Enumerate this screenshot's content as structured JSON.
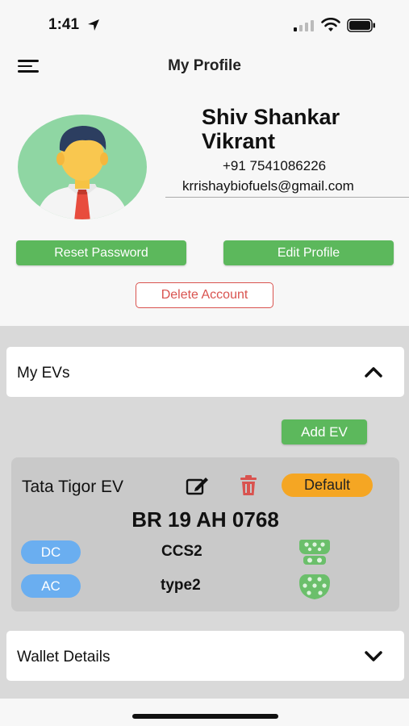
{
  "status_bar": {
    "time": "1:41"
  },
  "nav": {
    "title": "My Profile"
  },
  "profile": {
    "name": "Shiv Shankar Vikrant",
    "phone": "+91 7541086226",
    "email": "krrishaybiofuels@gmail.com",
    "reset_password_label": "Reset Password",
    "edit_profile_label": "Edit Profile",
    "delete_account_label": "Delete Account"
  },
  "sections": {
    "my_evs_label": "My EVs",
    "wallet_label": "Wallet Details"
  },
  "evs": {
    "add_label": "Add EV",
    "vehicle": {
      "name": "Tata Tigor EV",
      "default_label": "Default",
      "plate": "BR 19 AH 0768",
      "connectors": [
        {
          "current": "DC",
          "type": "CCS2",
          "icon": "ccs2-connector-icon"
        },
        {
          "current": "AC",
          "type": "type2",
          "icon": "type2-connector-icon"
        }
      ]
    }
  },
  "colors": {
    "primary_green": "#5cb85c",
    "danger_red": "#d9534f",
    "default_orange": "#f5a623",
    "pill_blue": "#6aaef0",
    "connector_green": "#6bbf6b"
  },
  "icons": {
    "menu": "hamburger-menu-icon",
    "edit": "edit-icon",
    "delete": "trash-icon",
    "expand_up": "chevron-up-icon",
    "expand_down": "chevron-down-icon"
  }
}
